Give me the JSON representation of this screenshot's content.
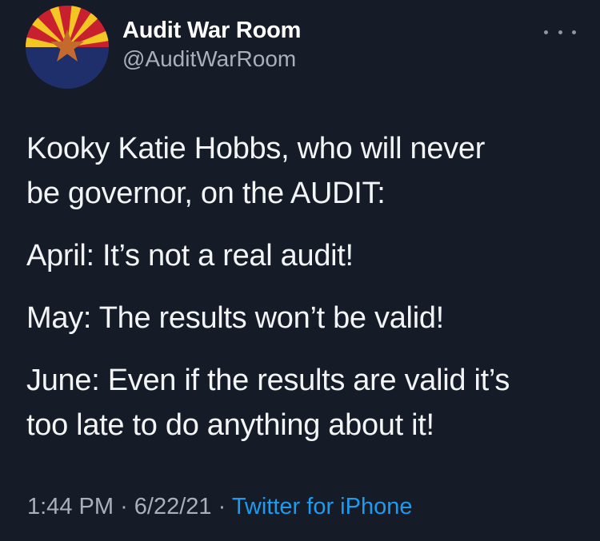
{
  "colors": {
    "background": "#151c27",
    "text": "#f2f4f5",
    "muted": "#a8b0ba",
    "link": "#1d9bf0"
  },
  "author": {
    "name": "Audit War Room",
    "handle": "@AuditWarRoom",
    "avatar_icon": "arizona-flag-avatar"
  },
  "menu": {
    "icon": "more-options-icon"
  },
  "tweet": {
    "paragraphs": [
      {
        "lines": [
          "Kooky Katie Hobbs, who will never",
          "be governor, on the AUDIT:"
        ]
      },
      {
        "lines": [
          "April: It’s not a real audit!"
        ]
      },
      {
        "lines": [
          "May: The results won’t be valid!"
        ]
      },
      {
        "lines": [
          "June: Even if the results are valid it’s",
          "too late to do anything about it!"
        ]
      }
    ]
  },
  "meta": {
    "time": "1:44 PM",
    "separator": "·",
    "date": "6/22/21",
    "source": "Twitter for iPhone"
  }
}
